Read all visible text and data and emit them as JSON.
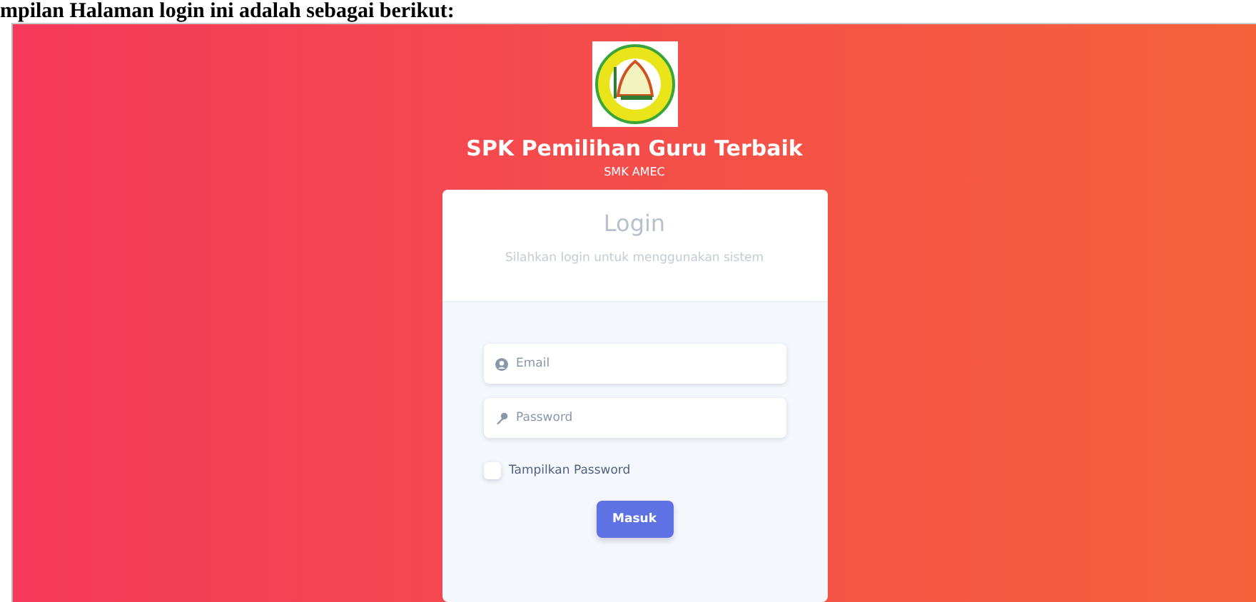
{
  "document_text": "mpilan Halaman login ini adalah sebagai berikut:",
  "header": {
    "title": "SPK Pemilihan Guru Terbaik",
    "subtitle": "SMK AMEC"
  },
  "card": {
    "title": "Login",
    "subtitle": "Silahkan login untuk menggunakan sistem",
    "fields": [
      {
        "kind": "email",
        "placeholder": "Email"
      },
      {
        "kind": "password",
        "placeholder": "Password"
      }
    ],
    "show_password": {
      "label": "Tampilkan Password",
      "checked": false
    },
    "submit": "Masuk"
  }
}
